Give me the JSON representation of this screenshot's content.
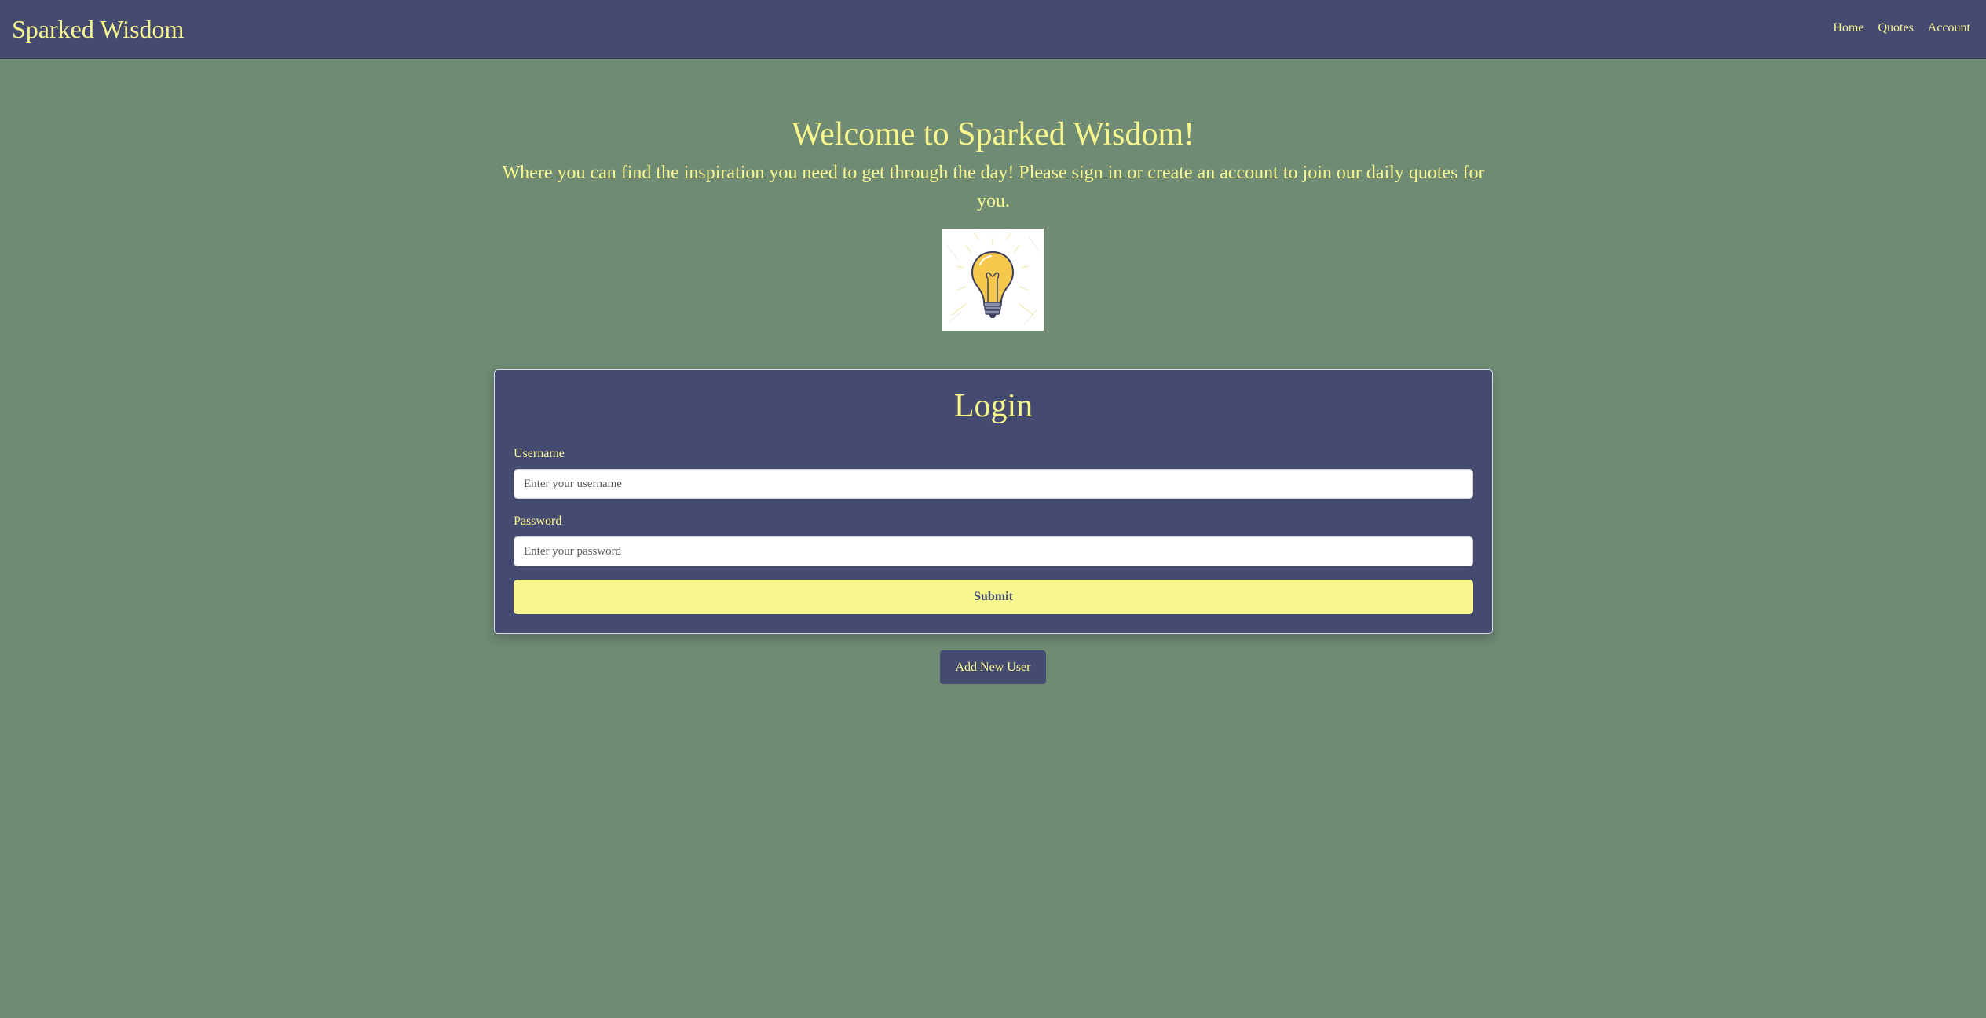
{
  "navbar": {
    "brand": "Sparked Wisdom",
    "links": [
      "Home",
      "Quotes",
      "Account"
    ]
  },
  "hero": {
    "title": "Welcome to Sparked Wisdom!",
    "subtitle": "Where you can find the inspiration you need to get through the day! Please sign in or create an account to join our daily quotes for you.",
    "image_icon": "lightbulb-icon"
  },
  "login": {
    "title": "Login",
    "username_label": "Username",
    "username_placeholder": "Enter your username",
    "username_value": "",
    "password_label": "Password",
    "password_placeholder": "Enter your password",
    "password_value": "",
    "submit_label": "Submit"
  },
  "add_user_label": "Add New User",
  "colors": {
    "background": "#6f8b74",
    "navbar": "#454a70",
    "accent_yellow": "#f7f78e"
  }
}
